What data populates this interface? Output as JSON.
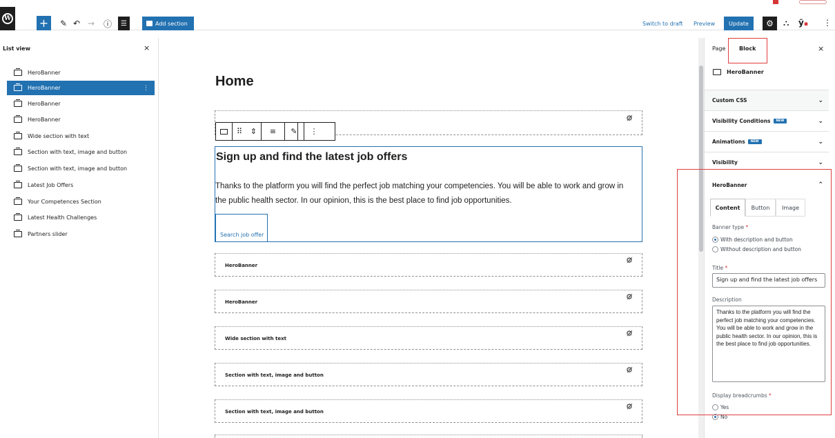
{
  "toolbar": {
    "add_section": "Add section",
    "switch_to_draft": "Switch to draft",
    "preview": "Preview",
    "update": "Update"
  },
  "list_view": {
    "title": "List view",
    "items": [
      {
        "label": "HeroBanner"
      },
      {
        "label": "HeroBanner"
      },
      {
        "label": "HeroBanner"
      },
      {
        "label": "HeroBanner"
      },
      {
        "label": "Wide section with text"
      },
      {
        "label": "Section with text, image and button"
      },
      {
        "label": "Section with text, image and button"
      },
      {
        "label": "Latest Job Offers"
      },
      {
        "label": "Your Competences Section"
      },
      {
        "label": "Latest Health Challenges"
      },
      {
        "label": "Partners slider"
      }
    ],
    "selected_index": 1
  },
  "canvas": {
    "page_title": "Home",
    "hero": {
      "title": "Sign up and find the latest job offers",
      "description": "Thanks to the platform you will find the perfect job matching your competencies. You will be able to work and grow in the public health sector. In our opinion, this is the best place to find job opportunities.",
      "button": "Search job offer"
    },
    "sections": [
      {
        "label": "HeroBanner"
      },
      {
        "label": "HeroBanner"
      },
      {
        "label": "Wide section with text"
      },
      {
        "label": "Section with text, image and button"
      },
      {
        "label": "Section with text, image and button"
      }
    ]
  },
  "sidebar": {
    "tab_page": "Page",
    "tab_block": "Block",
    "block_name": "HeroBanner",
    "panels": {
      "custom_css": "Custom CSS",
      "visibility_conditions": "Visibility Conditions",
      "animations": "Animations",
      "visibility": "Visibility",
      "new_badge": "NEW"
    },
    "herobanner_panel": {
      "title": "HeroBanner",
      "tabs": {
        "content": "Content",
        "button": "Button",
        "image": "Image"
      },
      "banner_type_label": "Banner type",
      "banner_type_options": {
        "with": "With description and button",
        "without": "Without description and button"
      },
      "title_label": "Title",
      "title_value": "Sign up and find the latest job offers",
      "description_label": "Description",
      "description_value": "Thanks to the platform you will find the perfect job matching your competencies. You will be able to work and grow in the public health sector. In our opinion, this is the best place to find job opportunities.",
      "breadcrumbs_label": "Display breadcrumbs",
      "breadcrumbs_options": {
        "yes": "Yes",
        "no": "No"
      },
      "required_mark": "*"
    }
  },
  "colors": {
    "accent": "#2271b1",
    "highlight": "#e03c3c",
    "dark": "#1e1e1e"
  }
}
